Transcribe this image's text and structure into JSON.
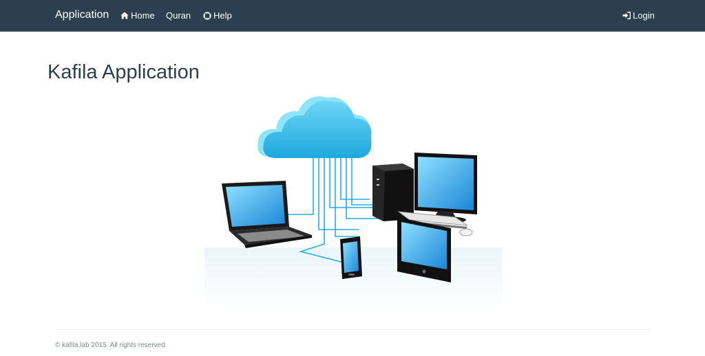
{
  "navbar": {
    "brand": "Application",
    "items": [
      {
        "label": "Home",
        "icon": "home-icon"
      },
      {
        "label": "Quran",
        "icon": ""
      },
      {
        "label": "Help",
        "icon": "lifebuoy-icon"
      }
    ],
    "login": {
      "label": "Login",
      "icon": "sign-in-icon"
    }
  },
  "main": {
    "title": "Kafila Application",
    "hero_image": "cloud-network-devices-illustration"
  },
  "footer": {
    "text": "© kafila.lab 2015. All rights reserved."
  },
  "colors": {
    "navbar": "#2c3e50",
    "title": "#2c3e50",
    "cloud": "#3bb9e6",
    "footer_text": "#7b8a8b"
  }
}
